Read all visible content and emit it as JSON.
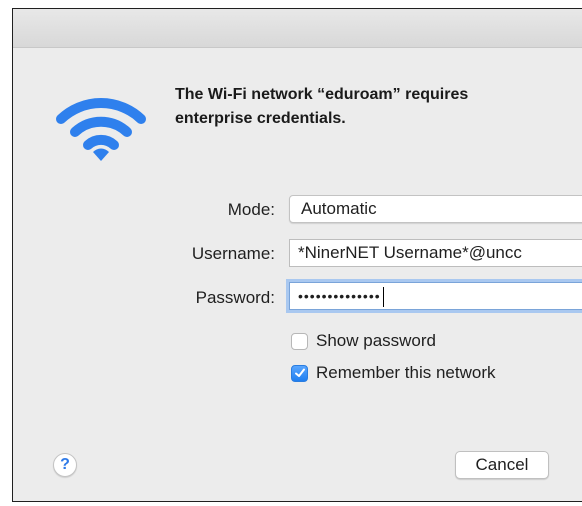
{
  "dialog": {
    "heading": "The Wi-Fi network “eduroam” requires\nenterprise credentials.",
    "wifi_icon": "wifi-icon",
    "accent_color": "#2f80ed"
  },
  "form": {
    "mode_label": "Mode:",
    "mode_value": "Automatic",
    "username_label": "Username:",
    "username_value": "*NinerNET Username*@uncc",
    "password_label": "Password:",
    "password_value": "••••••••••••••"
  },
  "options": {
    "show_password_label": "Show password",
    "show_password_checked": false,
    "remember_network_label": "Remember this network",
    "remember_network_checked": true
  },
  "buttons": {
    "help_label": "?",
    "cancel_label": "Cancel"
  }
}
